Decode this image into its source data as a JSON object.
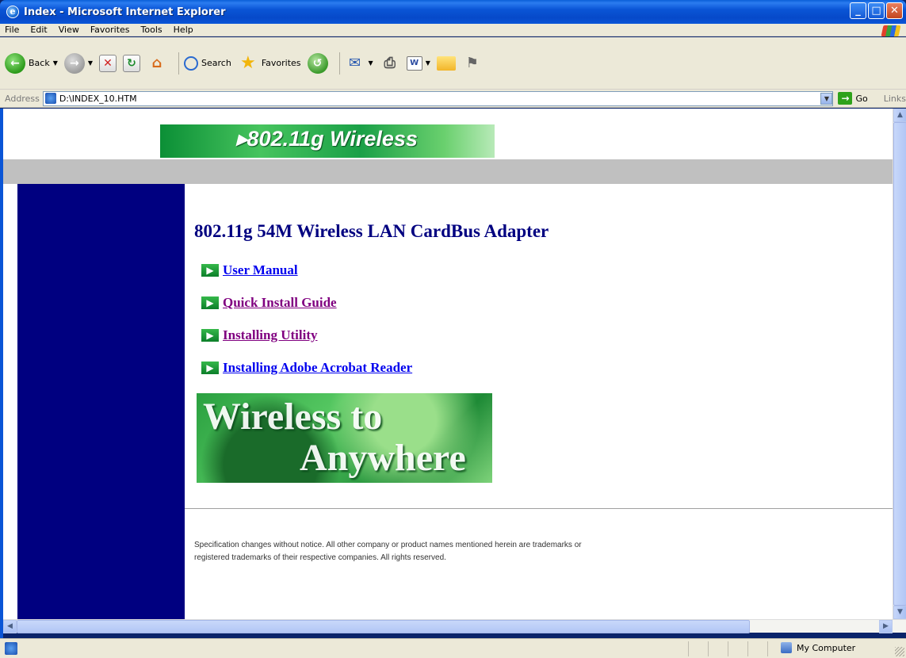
{
  "window": {
    "title": "Index - Microsoft Internet Explorer",
    "minimize_label": "_",
    "maximize_label": "□",
    "close_label": "✕"
  },
  "menu": {
    "items": [
      "File",
      "Edit",
      "View",
      "Favorites",
      "Tools",
      "Help"
    ]
  },
  "toolbar": {
    "back_label": "Back",
    "search_label": "Search",
    "favorites_label": "Favorites"
  },
  "address": {
    "label": "Address",
    "value": "D:\\INDEX_10.HTM",
    "go_label": "Go",
    "links_label": "Links"
  },
  "page": {
    "banner_text": "▸802.11g Wireless",
    "heading": "802.11g 54M Wireless LAN CardBus Adapter",
    "links": [
      {
        "label": "User Manual",
        "visited": false
      },
      {
        "label": "Quick Install Guide",
        "visited": true
      },
      {
        "label": "Installing Utility",
        "visited": true
      },
      {
        "label": "Installing Adobe Acrobat Reader",
        "visited": false
      }
    ],
    "image_line1": "Wireless to",
    "image_line2": "Anywhere",
    "footer_line1": "Specification changes without notice. All other company or product names mentioned herein are trademarks or",
    "footer_line2": "registered trademarks of their respective companies. All rights reserved."
  },
  "status": {
    "zone": "My Computer"
  },
  "icons": {
    "app": "ie-icon",
    "back": "back-arrow-icon",
    "forward": "forward-arrow-icon",
    "stop": "stop-icon",
    "refresh": "refresh-icon",
    "home": "home-icon",
    "search": "search-icon",
    "favorites": "star-icon",
    "history": "history-icon",
    "mail": "mail-icon",
    "print": "print-icon",
    "edit": "word-icon",
    "folder": "folder-icon",
    "messenger": "messenger-icon",
    "link_bullet": "green-arrow-icon"
  },
  "colors": {
    "sidebar": "#000080",
    "heading": "#000080",
    "link": "#0000ee",
    "visited_link": "#800080",
    "graybar": "#c0c0c0"
  }
}
